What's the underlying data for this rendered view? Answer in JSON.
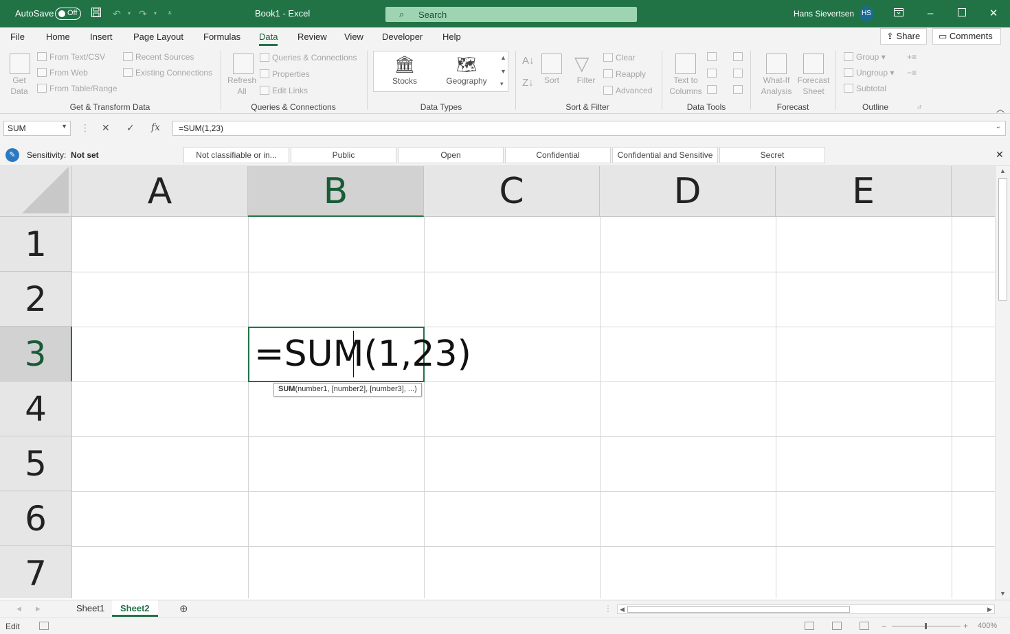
{
  "titlebar": {
    "autosave_label": "AutoSave",
    "autosave_state": "Off",
    "doc_title": "Book1  -  Excel",
    "search_placeholder": "Search",
    "user_name": "Hans Sievertsen",
    "user_initials": "HS"
  },
  "menu": {
    "tabs": [
      "File",
      "Home",
      "Insert",
      "Page Layout",
      "Formulas",
      "Data",
      "Review",
      "View",
      "Developer",
      "Help"
    ],
    "active_tab": "Data",
    "share_label": "Share",
    "comments_label": "Comments"
  },
  "ribbon": {
    "get_data": "Get\nData",
    "from_text_csv": "From Text/CSV",
    "from_web": "From Web",
    "from_table_range": "From Table/Range",
    "recent_sources": "Recent Sources",
    "existing_connections": "Existing Connections",
    "group_get_transform": "Get & Transform Data",
    "refresh_all": "Refresh\nAll",
    "queries_connections": "Queries & Connections",
    "properties": "Properties",
    "edit_links": "Edit Links",
    "group_queries": "Queries & Connections",
    "stocks": "Stocks",
    "geography": "Geography",
    "group_data_types": "Data Types",
    "sort": "Sort",
    "filter": "Filter",
    "clear": "Clear",
    "reapply": "Reapply",
    "advanced": "Advanced",
    "group_sort_filter": "Sort & Filter",
    "text_to_columns": "Text to\nColumns",
    "group_data_tools": "Data Tools",
    "what_if": "What-If\nAnalysis",
    "forecast_sheet": "Forecast\nSheet",
    "group_forecast": "Forecast",
    "group_btn": "Group",
    "ungroup_btn": "Ungroup",
    "subtotal": "Subtotal",
    "group_outline": "Outline"
  },
  "formula_bar": {
    "name_box": "SUM",
    "formula": "=SUM(1,23)"
  },
  "sensitivity": {
    "label": "Sensitivity:",
    "value": "Not set",
    "options": [
      "Not classifiable or in...",
      "Public",
      "Open",
      "Confidential",
      "Confidential and Sensitive",
      "Secret"
    ]
  },
  "grid": {
    "columns": [
      "A",
      "B",
      "C",
      "D",
      "E"
    ],
    "rows": [
      "1",
      "2",
      "3",
      "4",
      "5",
      "6",
      "7"
    ],
    "active_column": "B",
    "active_row": "3",
    "active_cell_text_before": "=SUM",
    "active_cell_text_after": "(1,23)",
    "tooltip_fn": "SUM",
    "tooltip_args": "(number1, [number2], [number3], ...)"
  },
  "sheets": {
    "tabs": [
      "Sheet1",
      "Sheet2"
    ],
    "active": "Sheet2"
  },
  "status": {
    "mode": "Edit",
    "zoom": "400%"
  },
  "colors": {
    "excel_green": "#217346",
    "selected_header": "#185c37"
  }
}
